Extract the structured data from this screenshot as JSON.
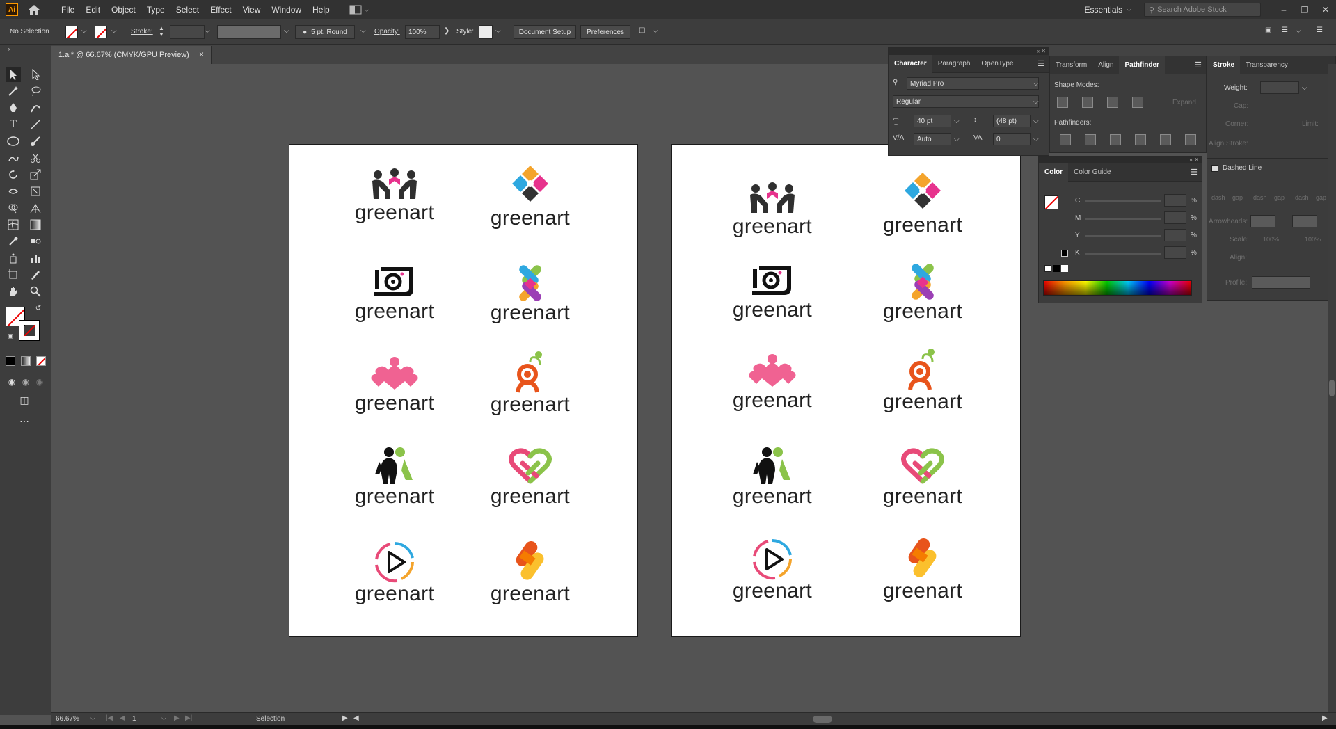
{
  "app": {
    "logo": "Ai"
  },
  "menu": [
    "File",
    "Edit",
    "Object",
    "Type",
    "Select",
    "Effect",
    "View",
    "Window",
    "Help"
  ],
  "workspace": {
    "label": "Essentials"
  },
  "stock_search": {
    "placeholder": "Search Adobe Stock"
  },
  "control": {
    "selection": "No Selection",
    "stroke_label": "Stroke:",
    "brush": "5 pt. Round",
    "opacity_label": "Opacity:",
    "opacity_value": "100%",
    "style_label": "Style:",
    "doc_setup": "Document Setup",
    "preferences": "Preferences"
  },
  "document_tab": {
    "title": "1.ai* @ 66.67% (CMYK/GPU Preview)",
    "close": "×"
  },
  "artboards": [
    {
      "logos": [
        "greenart",
        "greenart",
        "greenart",
        "greenart",
        "greenart",
        "greenart",
        "greenart",
        "greenart",
        "greenart",
        "greenart"
      ]
    },
    {
      "logos": [
        "greenart",
        "greenart",
        "greenart",
        "greenart",
        "greenart",
        "greenart",
        "greenart",
        "greenart",
        "greenart",
        "greenart"
      ]
    }
  ],
  "character_panel": {
    "tabs": [
      "Character",
      "Paragraph",
      "OpenType"
    ],
    "font": "Myriad Pro",
    "style": "Regular",
    "size": "40 pt",
    "leading": "(48 pt)",
    "kerning": "Auto",
    "tracking": "0"
  },
  "pathfinder_panel": {
    "tabs": [
      "Transform",
      "Align",
      "Pathfinder"
    ],
    "shape_modes": "Shape Modes:",
    "expand": "Expand",
    "pathfinders": "Pathfinders:"
  },
  "stroke_panel": {
    "tabs": [
      "Stroke",
      "Transparency"
    ],
    "weight": "Weight:",
    "cap": "Cap:",
    "corner": "Corner:",
    "limit": "Limit:",
    "align_stroke": "Align Stroke:",
    "dashed_line": "Dashed Line",
    "dash_labels": [
      "dash",
      "gap",
      "dash",
      "gap",
      "dash",
      "gap"
    ],
    "arrowheads": "Arrowheads:",
    "scale": "Scale:",
    "scale_values": [
      "100%",
      "100%"
    ],
    "align": "Align:",
    "profile": "Profile:"
  },
  "color_panel": {
    "tabs": [
      "Color",
      "Color Guide"
    ],
    "channels": [
      "C",
      "M",
      "Y",
      "K"
    ],
    "unit": "%"
  },
  "status": {
    "zoom": "66.67%",
    "page": "1",
    "tool": "Selection"
  },
  "colors": {
    "menubar": "#323232",
    "canvas": "#535353",
    "panel": "#3c3c3c",
    "accent_orange": "#ff9a00"
  }
}
